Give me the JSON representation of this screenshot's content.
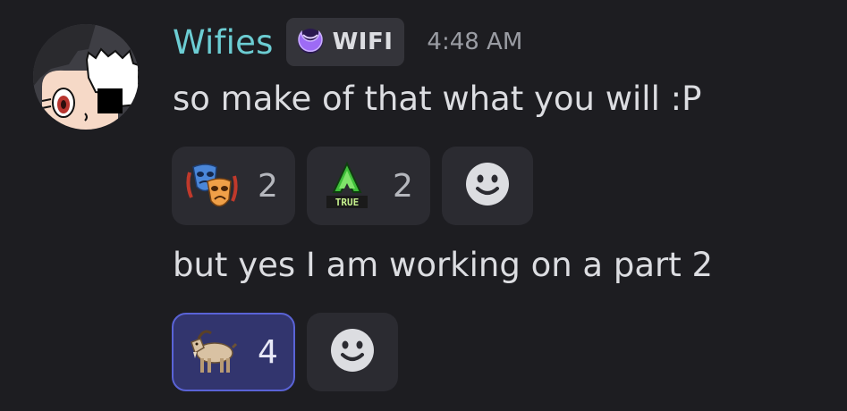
{
  "message": {
    "author": {
      "name": "Wifies",
      "name_color": "#6ccdd3",
      "tag": {
        "icon": "crescent-moon-icon",
        "label": "WIFI"
      }
    },
    "timestamp": "4:48 AM",
    "lines": [
      {
        "text": "so make of that what you will :P",
        "reactions": [
          {
            "emoji": "performing-arts-emoji",
            "count": "2",
            "selected": false
          },
          {
            "emoji": "true-custom-emoji",
            "count": "2",
            "selected": false
          }
        ],
        "add_reaction_icon": "smiley-face-icon"
      },
      {
        "text": "but yes I am working on a part 2",
        "reactions": [
          {
            "emoji": "goat-emoji",
            "count": "4",
            "selected": true
          }
        ],
        "add_reaction_icon": "smiley-face-icon"
      }
    ]
  },
  "colors": {
    "background": "#1d1d21",
    "reaction_bg": "#2b2b31",
    "reaction_selected_bg": "#32356e",
    "reaction_selected_border": "#5a63d6"
  }
}
